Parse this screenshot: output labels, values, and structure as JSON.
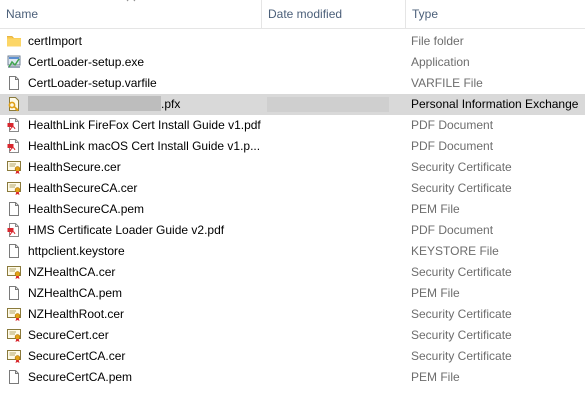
{
  "header": {
    "name": "Name",
    "date_modified": "Date modified",
    "type": "Type"
  },
  "files": [
    {
      "name": "certImport",
      "type": "File folder",
      "icon": "folder-icon"
    },
    {
      "name": "CertLoader-setup.exe",
      "type": "Application",
      "icon": "installer-icon"
    },
    {
      "name": "CertLoader-setup.varfile",
      "type": "VARFILE File",
      "icon": "generic-file-icon"
    },
    {
      "name": ".pfx",
      "type": "Personal Information Exchange",
      "icon": "pfx-icon",
      "selected": true
    },
    {
      "name": "HealthLink FireFox Cert Install Guide v1.pdf",
      "type": "PDF Document",
      "icon": "pdf-icon"
    },
    {
      "name": "HealthLink macOS Cert Install Guide v1.p...",
      "type": "PDF Document",
      "icon": "pdf-icon"
    },
    {
      "name": "HealthSecure.cer",
      "type": "Security Certificate",
      "icon": "certificate-icon"
    },
    {
      "name": "HealthSecureCA.cer",
      "type": "Security Certificate",
      "icon": "certificate-icon"
    },
    {
      "name": "HealthSecureCA.pem",
      "type": "PEM File",
      "icon": "generic-file-icon"
    },
    {
      "name": "HMS Certificate Loader Guide v2.pdf",
      "type": "PDF Document",
      "icon": "pdf-icon"
    },
    {
      "name": "httpclient.keystore",
      "type": "KEYSTORE File",
      "icon": "generic-file-icon"
    },
    {
      "name": "NZHealthCA.cer",
      "type": "Security Certificate",
      "icon": "certificate-icon"
    },
    {
      "name": "NZHealthCA.pem",
      "type": "PEM File",
      "icon": "generic-file-icon"
    },
    {
      "name": "NZHealthRoot.cer",
      "type": "Security Certificate",
      "icon": "certificate-icon"
    },
    {
      "name": "SecureCert.cer",
      "type": "Security Certificate",
      "icon": "certificate-icon"
    },
    {
      "name": "SecureCertCA.cer",
      "type": "Security Certificate",
      "icon": "certificate-icon"
    },
    {
      "name": "SecureCertCA.pem",
      "type": "PEM File",
      "icon": "generic-file-icon"
    }
  ]
}
